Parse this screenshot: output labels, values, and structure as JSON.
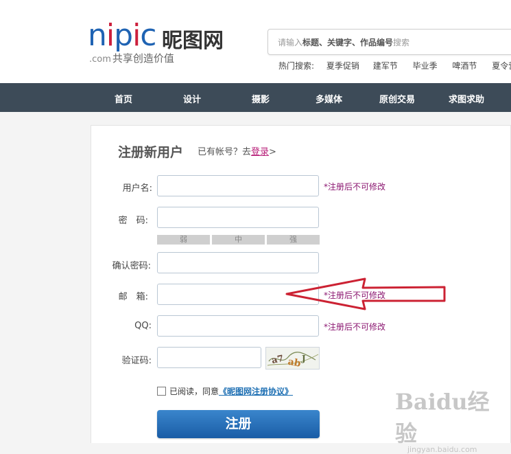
{
  "brand": {
    "logo_en": "nipic",
    "logo_cn": "昵图网",
    "domain": ".com",
    "slogan": "共享创造价值"
  },
  "search": {
    "placeholder_lead": "请输入",
    "placeholder_keywords": "标题、关键字、作品编号",
    "placeholder_tail": "搜索"
  },
  "hot_search": {
    "label": "热门搜索:",
    "items": [
      "夏季促销",
      "建军节",
      "毕业季",
      "啤酒节",
      "夏令营"
    ]
  },
  "nav": {
    "items": [
      "首页",
      "设计",
      "摄影",
      "多媒体",
      "原创交易",
      "求图求助"
    ]
  },
  "form": {
    "title": "注册新用户",
    "login_prompt": "已有帐号？去",
    "login_link": "登录",
    "login_suffix": ">",
    "fields": {
      "username": {
        "label": "用户名:",
        "note": "*注册后不可修改"
      },
      "password": {
        "label": "密　码:"
      },
      "confirm": {
        "label": "确认密码:"
      },
      "email": {
        "label": "邮　箱:",
        "note": "*注册后不可修改"
      },
      "qq": {
        "label": "QQ:",
        "note": "*注册后不可修改"
      },
      "captcha": {
        "label": "验证码:"
      }
    },
    "strength": [
      "弱",
      "中",
      "强"
    ],
    "agree_text": "已阅读，同意",
    "agree_link": "《昵图网注册协议》",
    "submit": "注册"
  },
  "colors": {
    "nav_bg": "#3d4b58",
    "accent": "#1f63b3",
    "note": "#8b1670",
    "arrow": "#cc2233"
  },
  "watermark": {
    "main": "Baidu经验",
    "sub": "jingyan.baidu.com"
  }
}
